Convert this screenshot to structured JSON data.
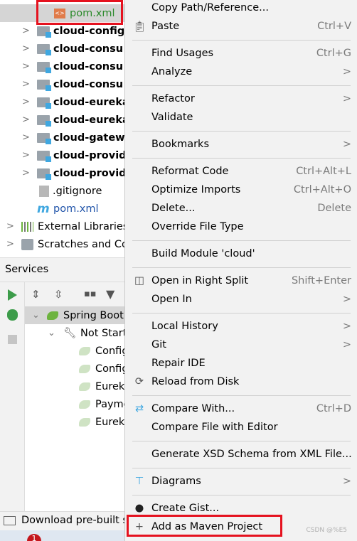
{
  "project_tree": {
    "selected_file": "pom.xml",
    "modules": [
      "cloud-config",
      "cloud-consu",
      "cloud-consu",
      "cloud-consu",
      "cloud-eureka",
      "cloud-eureka",
      "cloud-gatew",
      "cloud-provid",
      "cloud-provid"
    ],
    "files": [
      ".gitignore",
      "pom.xml"
    ],
    "external_libraries": "External Libraries",
    "scratches": "Scratches and Consoles"
  },
  "services": {
    "title": "Services",
    "root": "Spring Boot",
    "group": "Not Started",
    "items": [
      "Config",
      "Config",
      "Eureka",
      "Payment",
      "Eureka"
    ]
  },
  "download_bar": "Download pre-built shared indexes",
  "taskbar": {
    "badge": "1"
  },
  "context_menu": {
    "items": [
      {
        "label": "Copy Path/Reference...",
        "shortcut": ""
      },
      {
        "label": "Paste",
        "shortcut": "Ctrl+V",
        "icon": "clipboard-icon"
      },
      {
        "sep": true
      },
      {
        "label": "Find Usages",
        "shortcut": "Ctrl+G"
      },
      {
        "label": "Analyze",
        "submenu": true
      },
      {
        "sep": true
      },
      {
        "label": "Refactor",
        "submenu": true
      },
      {
        "label": "Validate"
      },
      {
        "sep": true
      },
      {
        "label": "Bookmarks",
        "submenu": true
      },
      {
        "sep": true
      },
      {
        "label": "Reformat Code",
        "shortcut": "Ctrl+Alt+L"
      },
      {
        "label": "Optimize Imports",
        "shortcut": "Ctrl+Alt+O"
      },
      {
        "label": "Delete...",
        "shortcut": "Delete"
      },
      {
        "label": "Override File Type"
      },
      {
        "sep": true
      },
      {
        "label": "Build Module 'cloud'"
      },
      {
        "sep": true
      },
      {
        "label": "Open in Right Split",
        "shortcut": "Shift+Enter",
        "icon": "split-icon"
      },
      {
        "label": "Open In",
        "submenu": true
      },
      {
        "sep": true
      },
      {
        "label": "Local History",
        "submenu": true
      },
      {
        "label": "Git",
        "submenu": true
      },
      {
        "label": "Repair IDE"
      },
      {
        "label": "Reload from Disk",
        "icon": "reload-icon"
      },
      {
        "sep": true
      },
      {
        "label": "Compare With...",
        "shortcut": "Ctrl+D",
        "icon": "compare-icon"
      },
      {
        "label": "Compare File with Editor"
      },
      {
        "sep": true
      },
      {
        "label": "Generate XSD Schema from XML File..."
      },
      {
        "sep": true
      },
      {
        "label": "Diagrams",
        "submenu": true,
        "icon": "diagram-icon"
      },
      {
        "sep": true
      },
      {
        "label": "Create Gist...",
        "icon": "github-icon"
      },
      {
        "label": "Add as Maven Project",
        "icon": "plus-icon",
        "highlighted_box": true
      }
    ]
  },
  "watermark": "CSDN @%E5",
  "colors": {
    "highlight_box": "#e5121f",
    "file_green": "#2c8a2c",
    "spring_green": "#6db33f"
  }
}
